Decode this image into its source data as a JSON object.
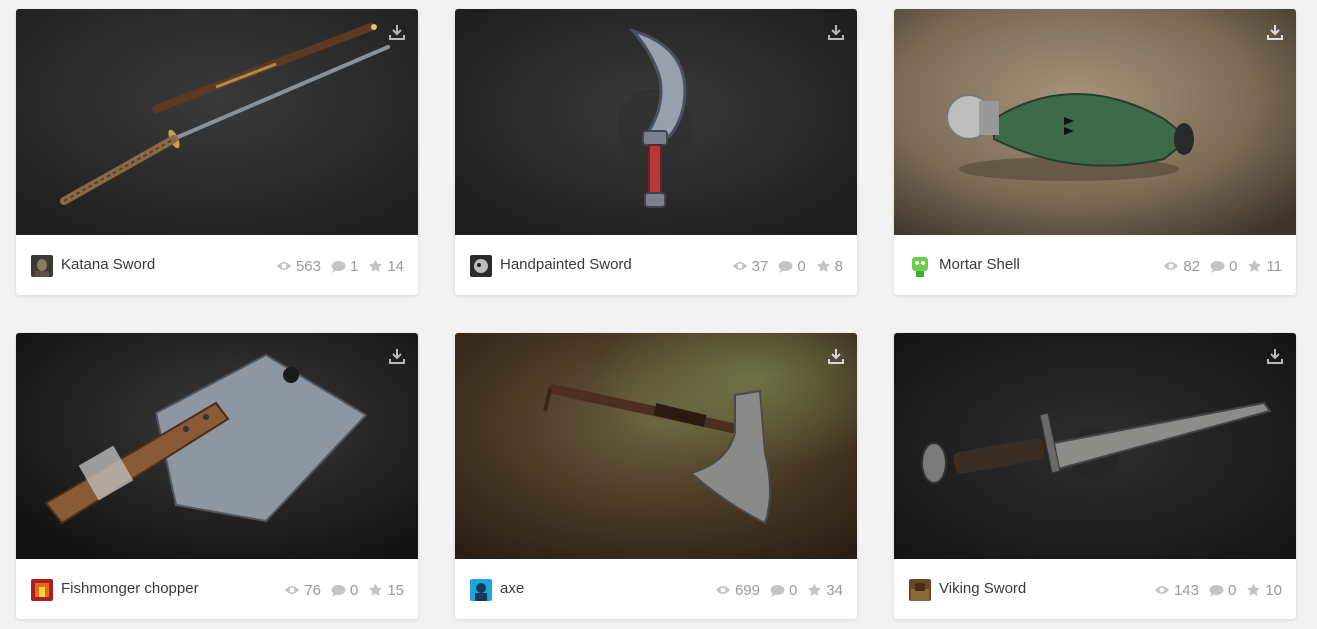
{
  "colors": {
    "page_bg": "#f2f2f2",
    "card_bg": "#ffffff",
    "title": "#3a3a3a",
    "stat": "#9a9a9a"
  },
  "models": [
    {
      "title": "Katana Sword",
      "views": "563",
      "comments": "1",
      "likes": "14",
      "thumbnail_bg": "#2b2b2b",
      "icons": [
        "eye-icon",
        "comment-icon",
        "star-icon",
        "download-icon"
      ]
    },
    {
      "title": "Handpainted Sword",
      "views": "37",
      "comments": "0",
      "likes": "8",
      "thumbnail_bg": "#262626"
    },
    {
      "title": "Mortar Shell",
      "views": "82",
      "comments": "0",
      "likes": "11",
      "thumbnail_bg": "#7a6a55"
    },
    {
      "title": "Fishmonger chopper",
      "views": "76",
      "comments": "0",
      "likes": "15",
      "thumbnail_bg": "#1e1e1e"
    },
    {
      "title": "axe",
      "views": "699",
      "comments": "0",
      "likes": "34",
      "thumbnail_bg": "#5a4a32"
    },
    {
      "title": "Viking Sword",
      "views": "143",
      "comments": "0",
      "likes": "10",
      "thumbnail_bg": "#1c1c1c"
    }
  ]
}
